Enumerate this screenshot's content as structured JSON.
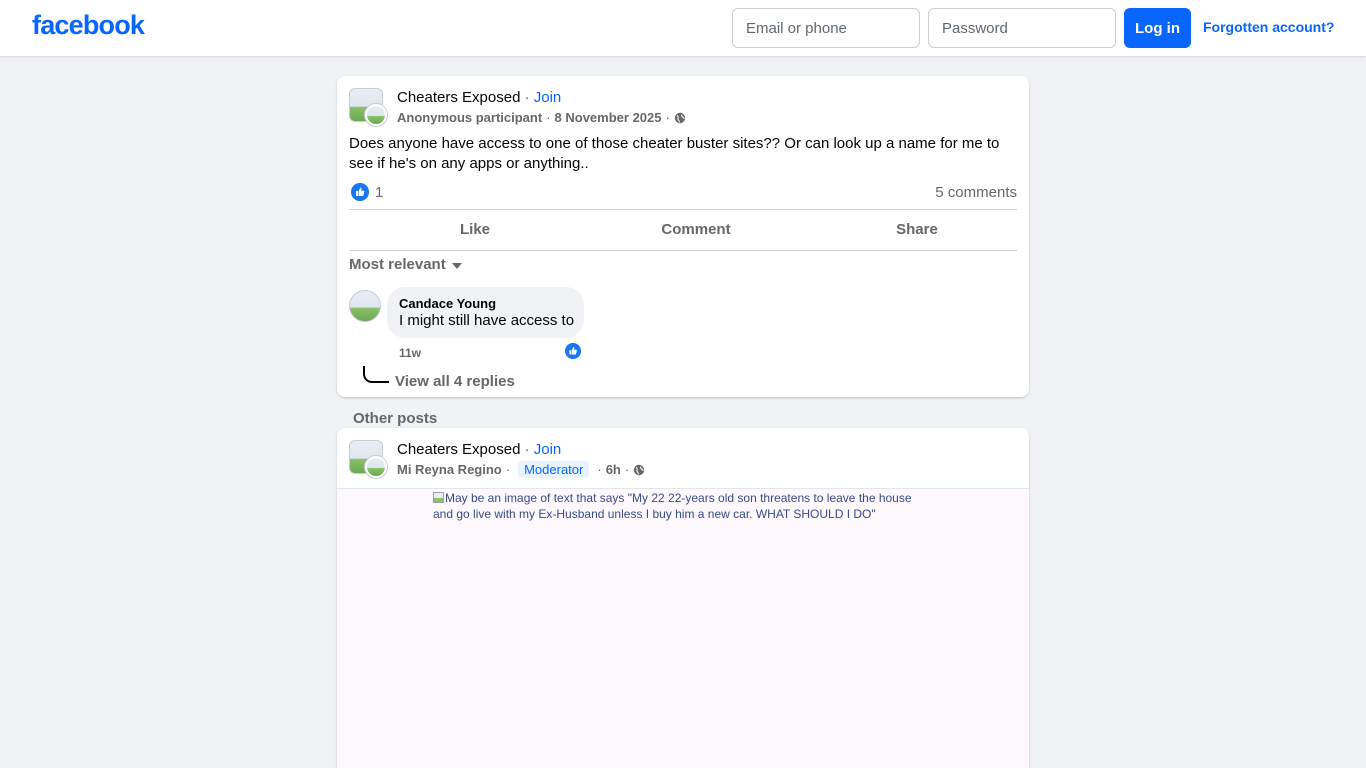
{
  "header": {
    "logo": "facebook",
    "email_placeholder": "Email or phone",
    "password_placeholder": "Password",
    "login_label": "Log in",
    "forgot_label": "Forgotten account?"
  },
  "post": {
    "group_name": "Cheaters Exposed",
    "join_label": "Join",
    "author": "Anonymous participant",
    "date": "8 November 2025",
    "text": "Does anyone have access to one of those cheater buster sites?? Or can look up a name for me to see if he's on any apps or anything..",
    "like_count": "1",
    "comments_count": "5 comments",
    "actions": {
      "like": "Like",
      "comment": "Comment",
      "share": "Share"
    },
    "sort_label": "Most relevant",
    "comment": {
      "author": "Candace Young",
      "text": "I might still have access to",
      "time": "11w",
      "view_replies": "View all 4 replies"
    }
  },
  "other_posts_label": "Other posts",
  "post2": {
    "group_name": "Cheaters Exposed",
    "join_label": "Join",
    "author": "Mi Reyna Regino",
    "badge": "Moderator",
    "time": "6h",
    "image_alt": "May be an image of text that says \"My 22 22-years old son threatens to leave the house and go live with my Ex-Husband unless I buy him a new car. WHAT SHOULD I DO\""
  },
  "colors": {
    "brand": "#0866ff",
    "background": "#f0f2f5",
    "secondary_text": "#65676b"
  },
  "icons": [
    "globe-icon",
    "like-icon",
    "caret-down-icon",
    "broken-image-icon"
  ]
}
